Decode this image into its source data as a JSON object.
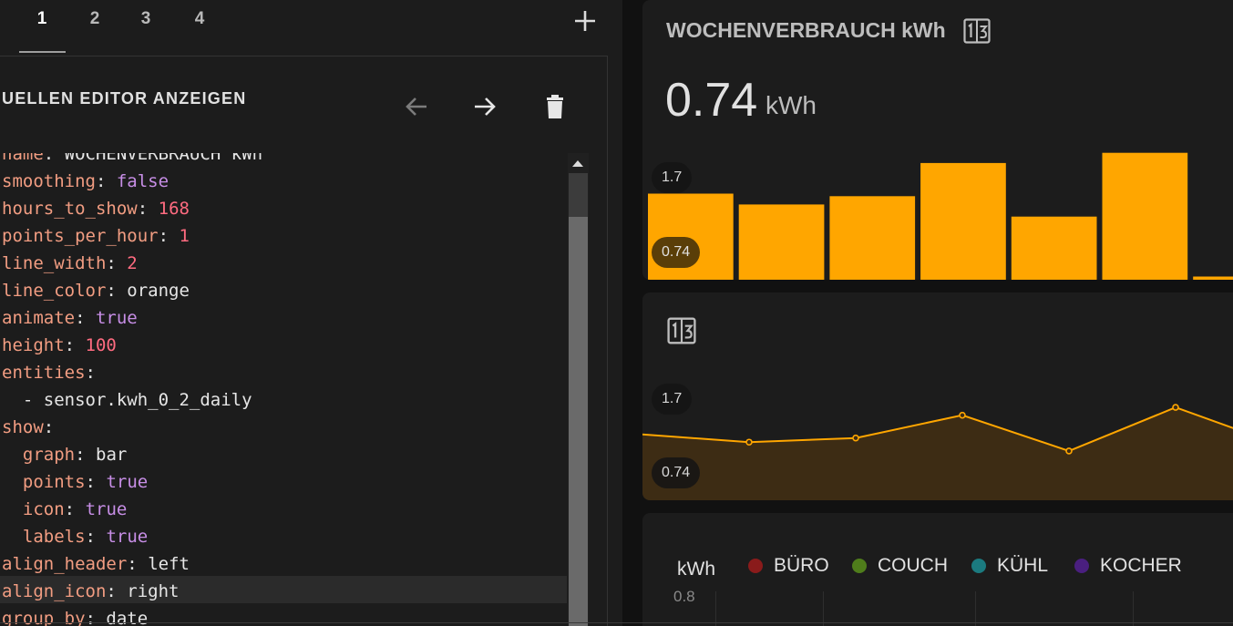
{
  "tabs": [
    {
      "label": "1",
      "active": true
    },
    {
      "label": "2",
      "active": false
    },
    {
      "label": "3",
      "active": false
    },
    {
      "label": "4",
      "active": false
    }
  ],
  "editor": {
    "toggle_label": "UELLEN EDITOR ANZEIGEN",
    "code_lines": [
      {
        "indent": "",
        "key": "name",
        "value": "WOCHENVERBRAUCH kWh",
        "type": "s"
      },
      {
        "indent": "",
        "key": "smoothing",
        "value": "false",
        "type": "kw"
      },
      {
        "indent": "",
        "key": "hours_to_show",
        "value": "168",
        "type": "num"
      },
      {
        "indent": "",
        "key": "points_per_hour",
        "value": "1",
        "type": "num"
      },
      {
        "indent": "",
        "key": "line_width",
        "value": "2",
        "type": "num"
      },
      {
        "indent": "",
        "key": "line_color",
        "value": "orange",
        "type": "s"
      },
      {
        "indent": "",
        "key": "animate",
        "value": "true",
        "type": "kw"
      },
      {
        "indent": "",
        "key": "height",
        "value": "100",
        "type": "num"
      },
      {
        "indent": "",
        "key": "entities",
        "value": "",
        "type": "s"
      },
      {
        "indent": "  ",
        "key": "",
        "value": "- sensor.kwh_0_2_daily",
        "type": "s"
      },
      {
        "indent": "",
        "key": "show",
        "value": "",
        "type": "s"
      },
      {
        "indent": "  ",
        "key": "graph",
        "value": "bar",
        "type": "s"
      },
      {
        "indent": "  ",
        "key": "points",
        "value": "true",
        "type": "kw"
      },
      {
        "indent": "  ",
        "key": "icon",
        "value": "true",
        "type": "kw"
      },
      {
        "indent": "  ",
        "key": "labels",
        "value": "true",
        "type": "kw"
      },
      {
        "indent": "",
        "key": "align_header",
        "value": "left",
        "type": "s"
      },
      {
        "indent": "",
        "key": "align_icon",
        "value": "right",
        "type": "s"
      },
      {
        "indent": "",
        "key": "group_by",
        "value": "date",
        "type": "s"
      }
    ]
  },
  "bar_card": {
    "title": "WOCHENVERBRAUCH kWh",
    "icon": "counter-icon",
    "state_value": "0.74",
    "unit": "kWh",
    "label_max": "1.7",
    "label_min": "0.74",
    "color": "#ffa600"
  },
  "line_card": {
    "icon": "counter-icon",
    "label_max": "1.7",
    "label_min": "0.74",
    "color": "#ffa600",
    "fill": "#3d2c14"
  },
  "energy_card": {
    "unit_label": "kWh",
    "tick_label": "0.8",
    "legend": [
      {
        "label": "BÜRO",
        "color": "#8a1b1b"
      },
      {
        "label": "COUCH",
        "color": "#4f7d1b"
      },
      {
        "label": "KÜHL",
        "color": "#1b7a7f"
      },
      {
        "label": "KOCHER",
        "color": "#4a1f7f"
      }
    ]
  },
  "chart_data": [
    {
      "type": "bar",
      "categories": [
        "1",
        "2",
        "3",
        "4",
        "5",
        "6",
        "7"
      ],
      "values": [
        1.35,
        1.18,
        1.31,
        1.83,
        0.99,
        1.99,
        0.05
      ],
      "title": "WOCHENVERBRAUCH kWh",
      "ylim": [
        0,
        2.1
      ]
    },
    {
      "type": "area",
      "x": [
        1,
        2,
        3,
        4,
        5,
        6,
        7
      ],
      "values": [
        1.27,
        1.12,
        1.2,
        1.64,
        0.95,
        1.79,
        1.05
      ],
      "ylim": [
        0,
        2.6
      ]
    }
  ]
}
